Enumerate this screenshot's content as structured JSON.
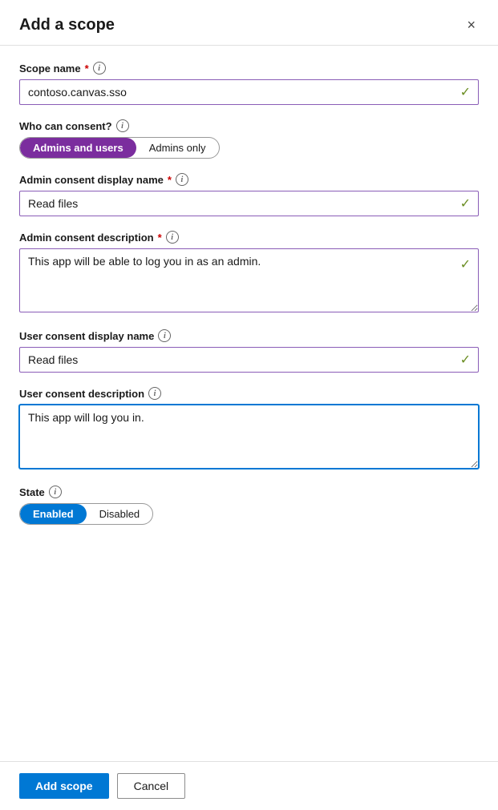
{
  "modal": {
    "title": "Add a scope",
    "close_label": "×"
  },
  "fields": {
    "scope_name": {
      "label": "Scope name",
      "required": true,
      "value": "contoso.canvas.sso",
      "info": "i"
    },
    "who_can_consent": {
      "label": "Who can consent?",
      "info": "i",
      "option_admins_users": "Admins and users",
      "option_admins_only": "Admins only"
    },
    "admin_consent_display_name": {
      "label": "Admin consent display name",
      "required": true,
      "value": "Read files",
      "info": "i"
    },
    "admin_consent_description": {
      "label": "Admin consent description",
      "required": true,
      "value": "This app will be able to log you in as an admin.",
      "info": "i"
    },
    "user_consent_display_name": {
      "label": "User consent display name",
      "value": "Read files",
      "info": "i"
    },
    "user_consent_description": {
      "label": "User consent description",
      "value": "This app will log you in.",
      "info": "i"
    },
    "state": {
      "label": "State",
      "info": "i",
      "option_enabled": "Enabled",
      "option_disabled": "Disabled"
    }
  },
  "footer": {
    "add_scope": "Add scope",
    "cancel": "Cancel"
  }
}
